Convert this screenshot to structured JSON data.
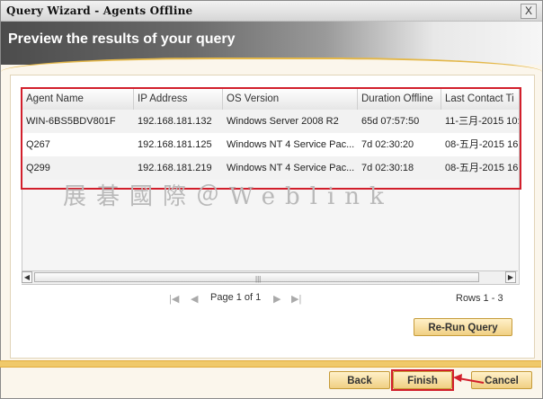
{
  "window": {
    "title": "Query Wizard - Agents Offline",
    "close_label": "X"
  },
  "header": {
    "title": "Preview the results of your query"
  },
  "table": {
    "columns": [
      "Agent Name",
      "IP Address",
      "OS Version",
      "Duration Offline",
      "Last Contact Ti"
    ],
    "rows": [
      [
        "WIN-6BS5BDV801F",
        "192.168.181.132",
        "Windows Server 2008 R2",
        "65d 07:57:50",
        "11-三月-2015 10:"
      ],
      [
        "Q267",
        "192.168.181.125",
        "Windows NT 4 Service Pac...",
        "7d 02:30:20",
        "08-五月-2015 16:"
      ],
      [
        "Q299",
        "192.168.181.219",
        "Windows NT 4 Service Pac...",
        "7d 02:30:18",
        "08-五月-2015 16:"
      ]
    ]
  },
  "watermark": "展碁國際＠Weblink",
  "pager": {
    "page_text": "Page 1 of 1",
    "rows_text": "Rows 1 - 3"
  },
  "buttons": {
    "rerun": "Re-Run Query",
    "back": "Back",
    "finish": "Finish",
    "cancel": "Cancel"
  },
  "colors": {
    "annotation": "#d21f2c",
    "accent": "#f0c96a",
    "button_fill": "#f0cf83"
  }
}
